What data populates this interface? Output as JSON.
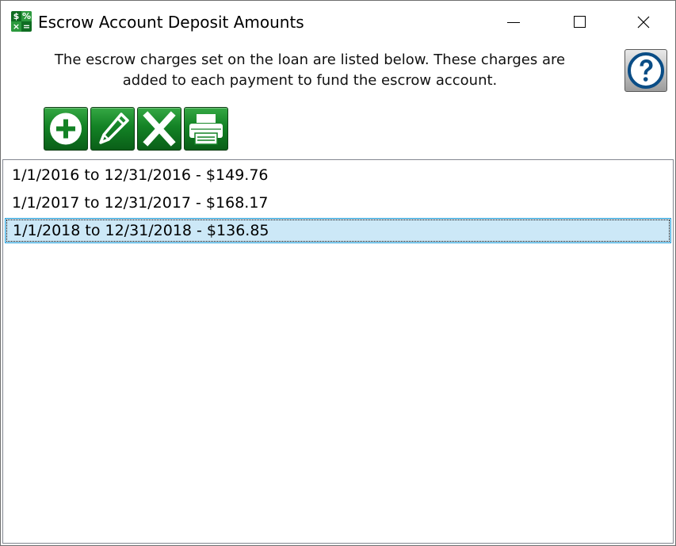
{
  "window": {
    "title": "Escrow Account Deposit Amounts",
    "icon": "calculator-icon",
    "icon_glyphs": [
      "$",
      "%",
      "×",
      "="
    ]
  },
  "description": "The escrow charges set on the loan are listed below. These charges are added to each payment to fund the escrow account.",
  "toolbar": {
    "buttons": [
      {
        "name": "add",
        "icon": "plus-circle-icon"
      },
      {
        "name": "edit",
        "icon": "pencil-icon"
      },
      {
        "name": "delete",
        "icon": "x-icon"
      },
      {
        "name": "print",
        "icon": "printer-icon"
      }
    ]
  },
  "help": {
    "icon": "question-icon"
  },
  "list": {
    "items": [
      {
        "label": "1/1/2016 to 12/31/2016 - $149.76",
        "selected": false
      },
      {
        "label": "1/1/2017 to 12/31/2017 - $168.17",
        "selected": false
      },
      {
        "label": "1/1/2018 to 12/31/2018 - $136.85",
        "selected": true
      }
    ]
  },
  "colors": {
    "toolbar_green": "#138225",
    "selection_fill": "#cce8f7",
    "selection_border": "#26a0da",
    "help_blue": "#0a4d86"
  }
}
